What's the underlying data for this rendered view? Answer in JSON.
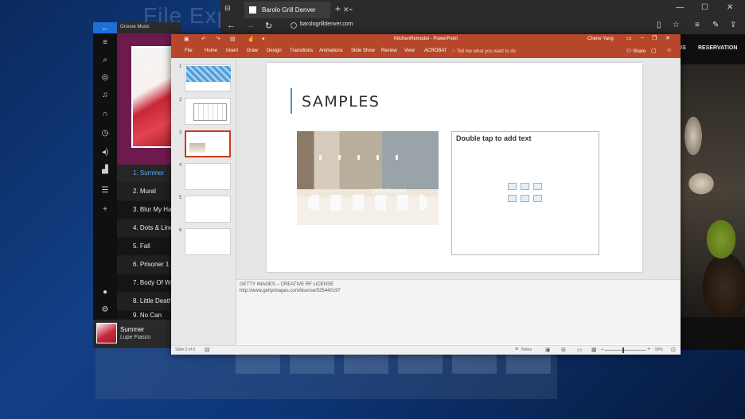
{
  "desktop": {
    "explorer_title": "File Expl"
  },
  "groove": {
    "title": "Groove Music",
    "back_icon": "back-arrow-icon",
    "rail_icons": [
      "hamburger-icon",
      "search-icon",
      "radio-icon",
      "music-note-icon",
      "headphones-icon",
      "clock-icon",
      "now-playing-icon",
      "chart-icon",
      "playlist-icon",
      "add-icon",
      "avatar",
      "gear-icon"
    ],
    "tracks": [
      "1.  Summer",
      "2.  Mural",
      "3.  Blur My Hands",
      "4.  Dots & Lines",
      "5.  Fall",
      "6.  Prisoner 1 & 2",
      "7.  Body Of Work",
      "8.  Little Death",
      "9.  No Can"
    ],
    "now_playing": {
      "title": "Summer",
      "artist": "Lupe Fiasco"
    }
  },
  "edge": {
    "tab_title": "Barolo Grill Denver",
    "url": "barologrilldenver.com",
    "site_nav": [
      "RDS",
      "RESERVATION"
    ]
  },
  "ppt": {
    "doc_title": "KitchenRemodel - PowerPoint",
    "user": "Cherie Yang",
    "ribbon_tabs": [
      "File",
      "Home",
      "Insert",
      "Draw",
      "Design",
      "Transitions",
      "Animations",
      "Slide Show",
      "Review",
      "View",
      "ACROBAT"
    ],
    "tell_me": "Tell me what you want to do",
    "share": "Share",
    "slide_numbers": [
      "1",
      "2",
      "3",
      "4",
      "5",
      "6"
    ],
    "slide_title": "SAMPLES",
    "image_watermark": "gettyimages",
    "placeholder_text": "Double tap to add text",
    "notes": [
      "GETTY IMAGES – CREATIVE RF LICENSE",
      "http://www.gettyimages.com/license/525440197"
    ],
    "status": {
      "slide_indicator": "Slide 3 of 6",
      "notes_label": "Notes",
      "zoom": "99%"
    },
    "accent_color": "#b7472a"
  }
}
